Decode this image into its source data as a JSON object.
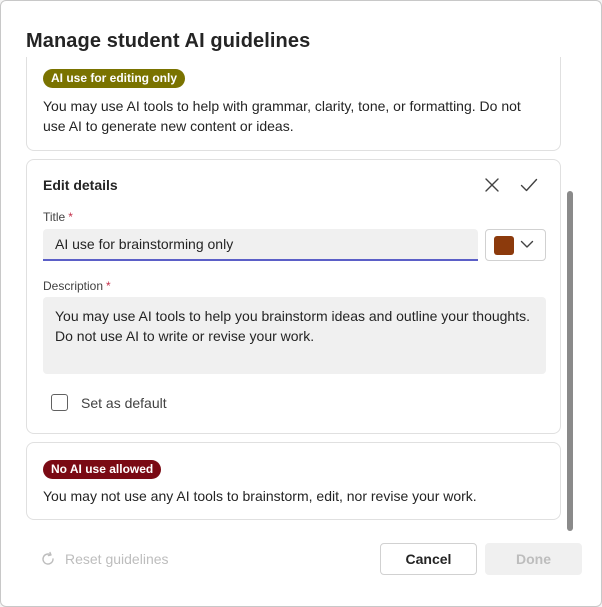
{
  "dialog": {
    "title": "Manage student AI guidelines"
  },
  "guidelines": [
    {
      "badge": "AI use for editing only",
      "badge_color": "#7a7300",
      "description": "You may use AI tools to help with grammar, clarity, tone, or formatting. Do not use AI to generate new content or ideas."
    },
    {
      "badge": "No AI use allowed",
      "badge_color": "#7a0a14",
      "description": "You may not use any AI tools to brainstorm, edit, nor revise your work."
    }
  ],
  "edit": {
    "heading": "Edit details",
    "title_label": "Title",
    "title_value": "AI use for brainstorming only",
    "required_mark": "*",
    "color_value": "#8c3a0c",
    "description_label": "Description",
    "description_value": "You may use AI tools to help you brainstorm ideas and outline your thoughts. Do not use AI to write or revise your work.",
    "default_label": "Set as default",
    "default_checked": false
  },
  "icons": {
    "close": "close-icon",
    "confirm": "checkmark-icon",
    "dropdown": "chevron-down-icon",
    "reset": "reset-icon"
  },
  "footer": {
    "reset_label": "Reset guidelines",
    "cancel_label": "Cancel",
    "done_label": "Done"
  },
  "colors": {
    "accent": "#5b5fc7",
    "required": "#c4314b"
  }
}
